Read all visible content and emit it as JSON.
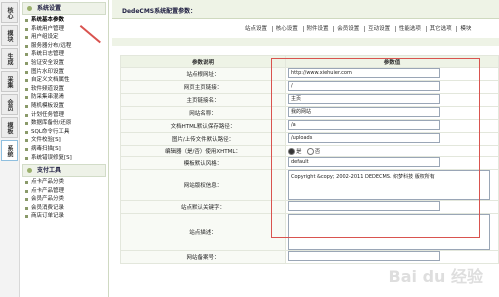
{
  "leftnav": [
    "核心",
    "模块",
    "生成",
    "采集",
    "会员",
    "模板",
    "系统"
  ],
  "menu": {
    "groups": [
      {
        "title": "系统设置",
        "items": [
          "系统基本参数",
          "系统用户管理",
          "用户组设定",
          "服务器分布/远程",
          "系统日志管理",
          "验证安全设置",
          "图片水印设置",
          "自定义文档属性",
          "软件频道设置",
          "防采集串混淆",
          "随机模板设置",
          "计划任务管理",
          "数据库备份/还原",
          "SQL命令行工具",
          "文件校验[S]",
          "病毒扫描[S]",
          "系统错误修复[S]"
        ]
      },
      {
        "title": "支付工具",
        "items": [
          "点卡产品分类",
          "点卡产品管理",
          "会员产品分类",
          "会员消费记录",
          "商店订单记录"
        ]
      }
    ],
    "active": "系统基本参数"
  },
  "header": {
    "title": "DedeCMS系统配置参数："
  },
  "tabs": [
    "站点设置",
    "核心设置",
    "附件设置",
    "会员设置",
    "互动设置",
    "性能选项",
    "其它选项",
    "模块"
  ],
  "table": {
    "col_label": "参数说明",
    "col_value": "参数值",
    "rows": [
      {
        "label": "站点根网址：",
        "value": "http://www.xiehuier.com"
      },
      {
        "label": "网页主页链接：",
        "value": "/"
      },
      {
        "label": "主页链接名：",
        "value": "主页"
      },
      {
        "label": "网站名称：",
        "value": "我的网站"
      },
      {
        "label": "文档HTML默认保存路径：",
        "value": "/a"
      },
      {
        "label": "图片/上传文件默认路径：",
        "value": "/uploads"
      },
      {
        "label": "编辑器（是/否）使用XHTML：",
        "value": "",
        "radio": [
          "是",
          "否"
        ]
      },
      {
        "label": "模板默认风格：",
        "value": "default"
      },
      {
        "label": "网站版权信息：",
        "value": "Copyright &copy; 2002-2011 DEDECMS. 织梦科技 版权所有"
      },
      {
        "label": "站点默认关键字：",
        "value": ""
      },
      {
        "label": "站点描述：",
        "value": ""
      },
      {
        "label": "网站备案号：",
        "value": ""
      }
    ]
  },
  "watermark": "Bai du 经验"
}
